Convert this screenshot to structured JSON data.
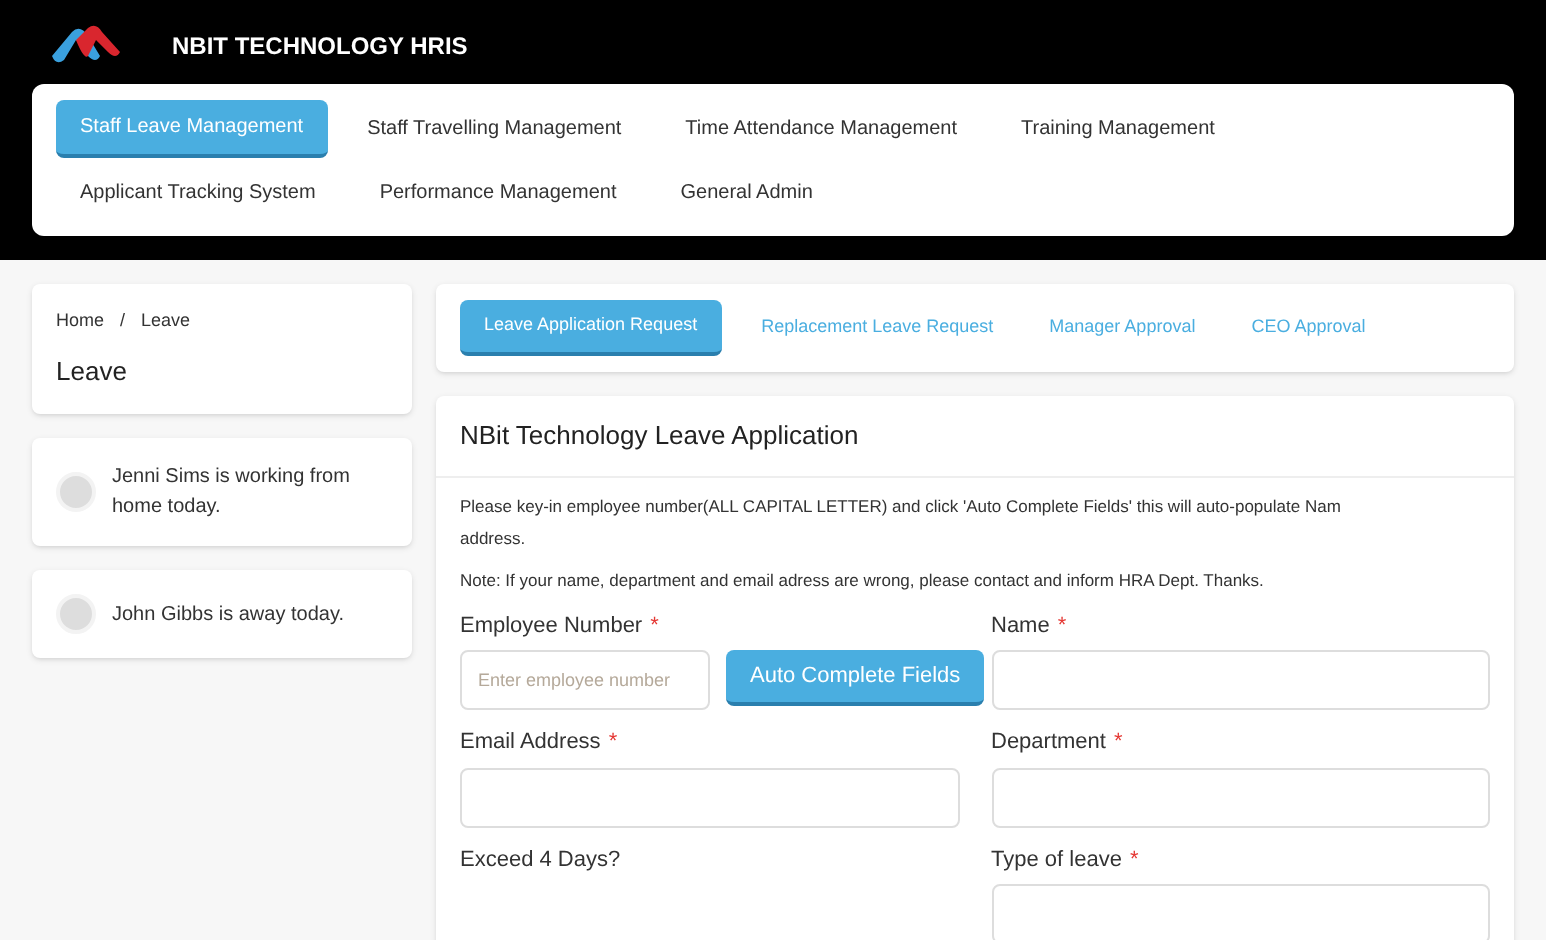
{
  "header": {
    "title": "NBIT TECHNOLOGY HRIS"
  },
  "nav_tabs": [
    {
      "label": "Staff Leave Management",
      "selected": true
    },
    {
      "label": "Staff Travelling Management",
      "selected": false
    },
    {
      "label": "Time Attendance Management",
      "selected": false
    },
    {
      "label": "Training Management",
      "selected": false
    },
    {
      "label": "Applicant Tracking System",
      "selected": false
    },
    {
      "label": "Performance Management",
      "selected": false
    },
    {
      "label": "General Admin",
      "selected": false
    }
  ],
  "breadcrumb": {
    "items": [
      "Home",
      "Leave"
    ],
    "separator": "/",
    "page_title": "Leave"
  },
  "status_cards": [
    {
      "text": "Jenni Sims is working from home today."
    },
    {
      "text": "John Gibbs is away today."
    }
  ],
  "sub_tabs": [
    {
      "label": "Leave Application Request",
      "selected": true
    },
    {
      "label": "Replacement Leave Request",
      "selected": false
    },
    {
      "label": "Manager Approval",
      "selected": false
    },
    {
      "label": "CEO Approval",
      "selected": false
    }
  ],
  "form": {
    "title": "NBit Technology Leave Application",
    "intro_lines": [
      "Please key-in employee number(ALL CAPITAL LETTER) and click 'Auto Complete Fields' this will auto-populate Nam",
      "address."
    ],
    "note": "Note: If your name, department and email adress are wrong, please contact and inform HRA Dept. Thanks.",
    "left_fields": [
      {
        "label": "Employee Number",
        "mark": "*",
        "kind": "input_button",
        "placeholder": "Enter employee number",
        "button": "Auto Complete Fields"
      },
      {
        "label": "Email Address",
        "mark": "*",
        "kind": "input"
      },
      {
        "label": "Exceed 4 Days?",
        "kind": "label"
      }
    ],
    "right_fields": [
      {
        "label": "Name",
        "mark": "*",
        "kind": "input"
      },
      {
        "label": "Department",
        "mark": "*",
        "kind": "input"
      },
      {
        "label": "Type of leave",
        "mark": "*",
        "kind": "input"
      }
    ]
  }
}
